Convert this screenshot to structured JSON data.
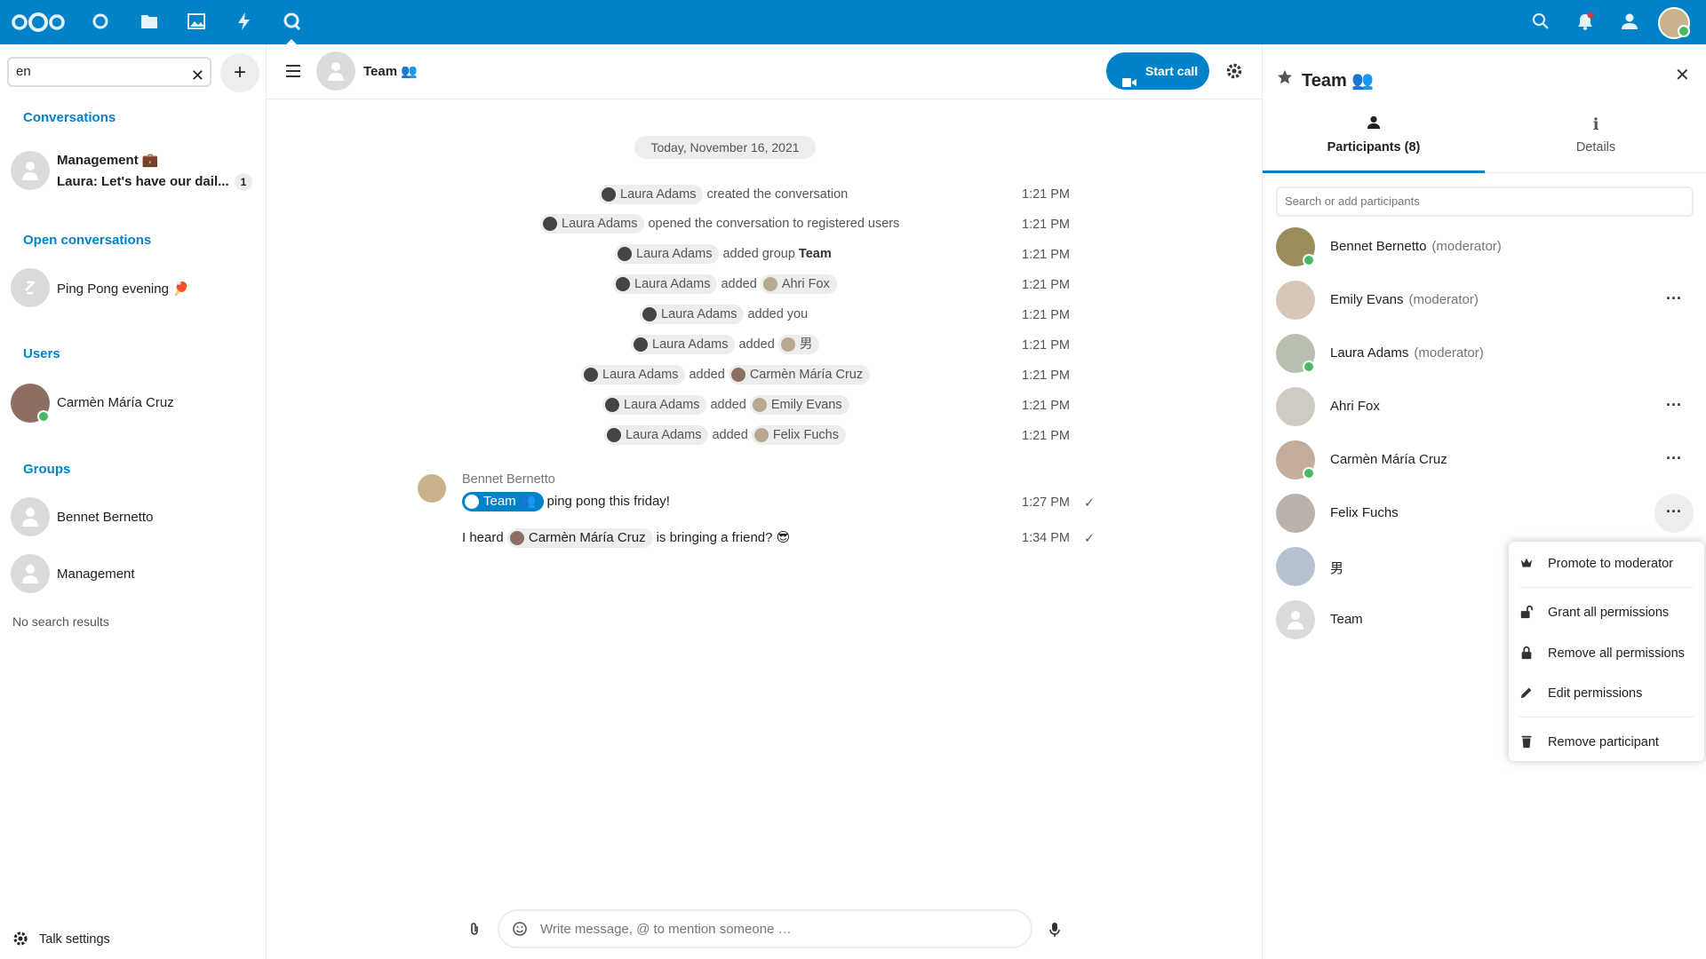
{
  "topbar": {
    "nav_icons": [
      "nextcloud-logo",
      "dashboard-icon",
      "files-icon",
      "photos-icon",
      "activity-icon",
      "talk-icon"
    ],
    "right_icons": [
      "search-icon",
      "notifications-icon",
      "contacts-icon",
      "user-avatar"
    ]
  },
  "left": {
    "search_value": "en",
    "sections": {
      "conversations": "Conversations",
      "open_conversations": "Open conversations",
      "users": "Users",
      "groups": "Groups"
    },
    "conversations": [
      {
        "name": "Management 💼",
        "preview": "Laura: Let's have our dail...",
        "unread": "1"
      }
    ],
    "open_conversations": [
      {
        "name": "Ping Pong evening 🏓"
      }
    ],
    "users": [
      {
        "name": "Carmèn Máría Cruz"
      }
    ],
    "groups": [
      {
        "name": "Bennet Bernetto"
      },
      {
        "name": "Management"
      }
    ],
    "no_results": "No search results",
    "settings_label": "Talk settings"
  },
  "chat": {
    "title": "Team 👥",
    "start_call": "Start call",
    "date_separator": "Today, November 16, 2021",
    "system_messages": [
      {
        "actor": "Laura Adams",
        "text": "created the conversation",
        "target": "",
        "bold": "",
        "time": "1:21 PM"
      },
      {
        "actor": "Laura Adams",
        "text": "opened the conversation to registered users",
        "target": "",
        "bold": "",
        "time": "1:21 PM"
      },
      {
        "actor": "Laura Adams",
        "text": "added group",
        "target": "",
        "bold": "Team",
        "time": "1:21 PM"
      },
      {
        "actor": "Laura Adams",
        "text": "added",
        "target": "Ahri Fox",
        "bold": "",
        "time": "1:21 PM"
      },
      {
        "actor": "Laura Adams",
        "text": "added you",
        "target": "",
        "bold": "",
        "time": "1:21 PM"
      },
      {
        "actor": "Laura Adams",
        "text": "added",
        "target": "男",
        "bold": "",
        "time": "1:21 PM"
      },
      {
        "actor": "Laura Adams",
        "text": "added",
        "target": "Carmèn Máría Cruz",
        "bold": "",
        "time": "1:21 PM"
      },
      {
        "actor": "Laura Adams",
        "text": "added",
        "target": "Emily Evans",
        "bold": "",
        "time": "1:21 PM"
      },
      {
        "actor": "Laura Adams",
        "text": "added",
        "target": "Felix Fuchs",
        "bold": "",
        "time": "1:21 PM"
      }
    ],
    "messages": [
      {
        "author": "Bennet Bernetto",
        "mention": "Team 👥",
        "text": "ping pong this friday!",
        "time": "1:27 PM"
      },
      {
        "author": "",
        "prefix": "I heard",
        "mention": "Carmèn Máría Cruz",
        "text": "is bringing a friend? 😎",
        "time": "1:34 PM"
      }
    ],
    "composer_placeholder": "Write message, @ to mention someone …"
  },
  "right": {
    "title": "Team 👥",
    "tabs": [
      {
        "label": "Participants (8)",
        "active": true
      },
      {
        "label": "Details",
        "active": false
      }
    ],
    "search_placeholder": "Search or add participants",
    "participants": [
      {
        "name": "Bennet Bernetto",
        "role": "(moderator)",
        "online": true,
        "more": false
      },
      {
        "name": "Emily Evans",
        "role": "(moderator)",
        "online": false,
        "more": true
      },
      {
        "name": "Laura Adams",
        "role": "(moderator)",
        "online": true,
        "more": false
      },
      {
        "name": "Ahri Fox",
        "role": "",
        "online": false,
        "more": true
      },
      {
        "name": "Carmèn Máría Cruz",
        "role": "",
        "online": true,
        "more": true
      },
      {
        "name": "Felix Fuchs",
        "role": "",
        "online": false,
        "more": true
      },
      {
        "name": "男",
        "role": "",
        "online": false,
        "more": false
      },
      {
        "name": "Team",
        "role": "",
        "online": false,
        "more": false
      }
    ],
    "menu": [
      {
        "label": "Promote to moderator",
        "icon": "crown-icon"
      },
      {
        "label": "Grant all permissions",
        "icon": "unlock-icon"
      },
      {
        "label": "Remove all permissions",
        "icon": "lock-icon"
      },
      {
        "label": "Edit permissions",
        "icon": "pencil-icon"
      },
      {
        "label": "Remove participant",
        "icon": "trash-icon"
      }
    ]
  },
  "colors": {
    "brand": "#0082c9",
    "online": "#46ba61",
    "hover": "#ededed"
  }
}
